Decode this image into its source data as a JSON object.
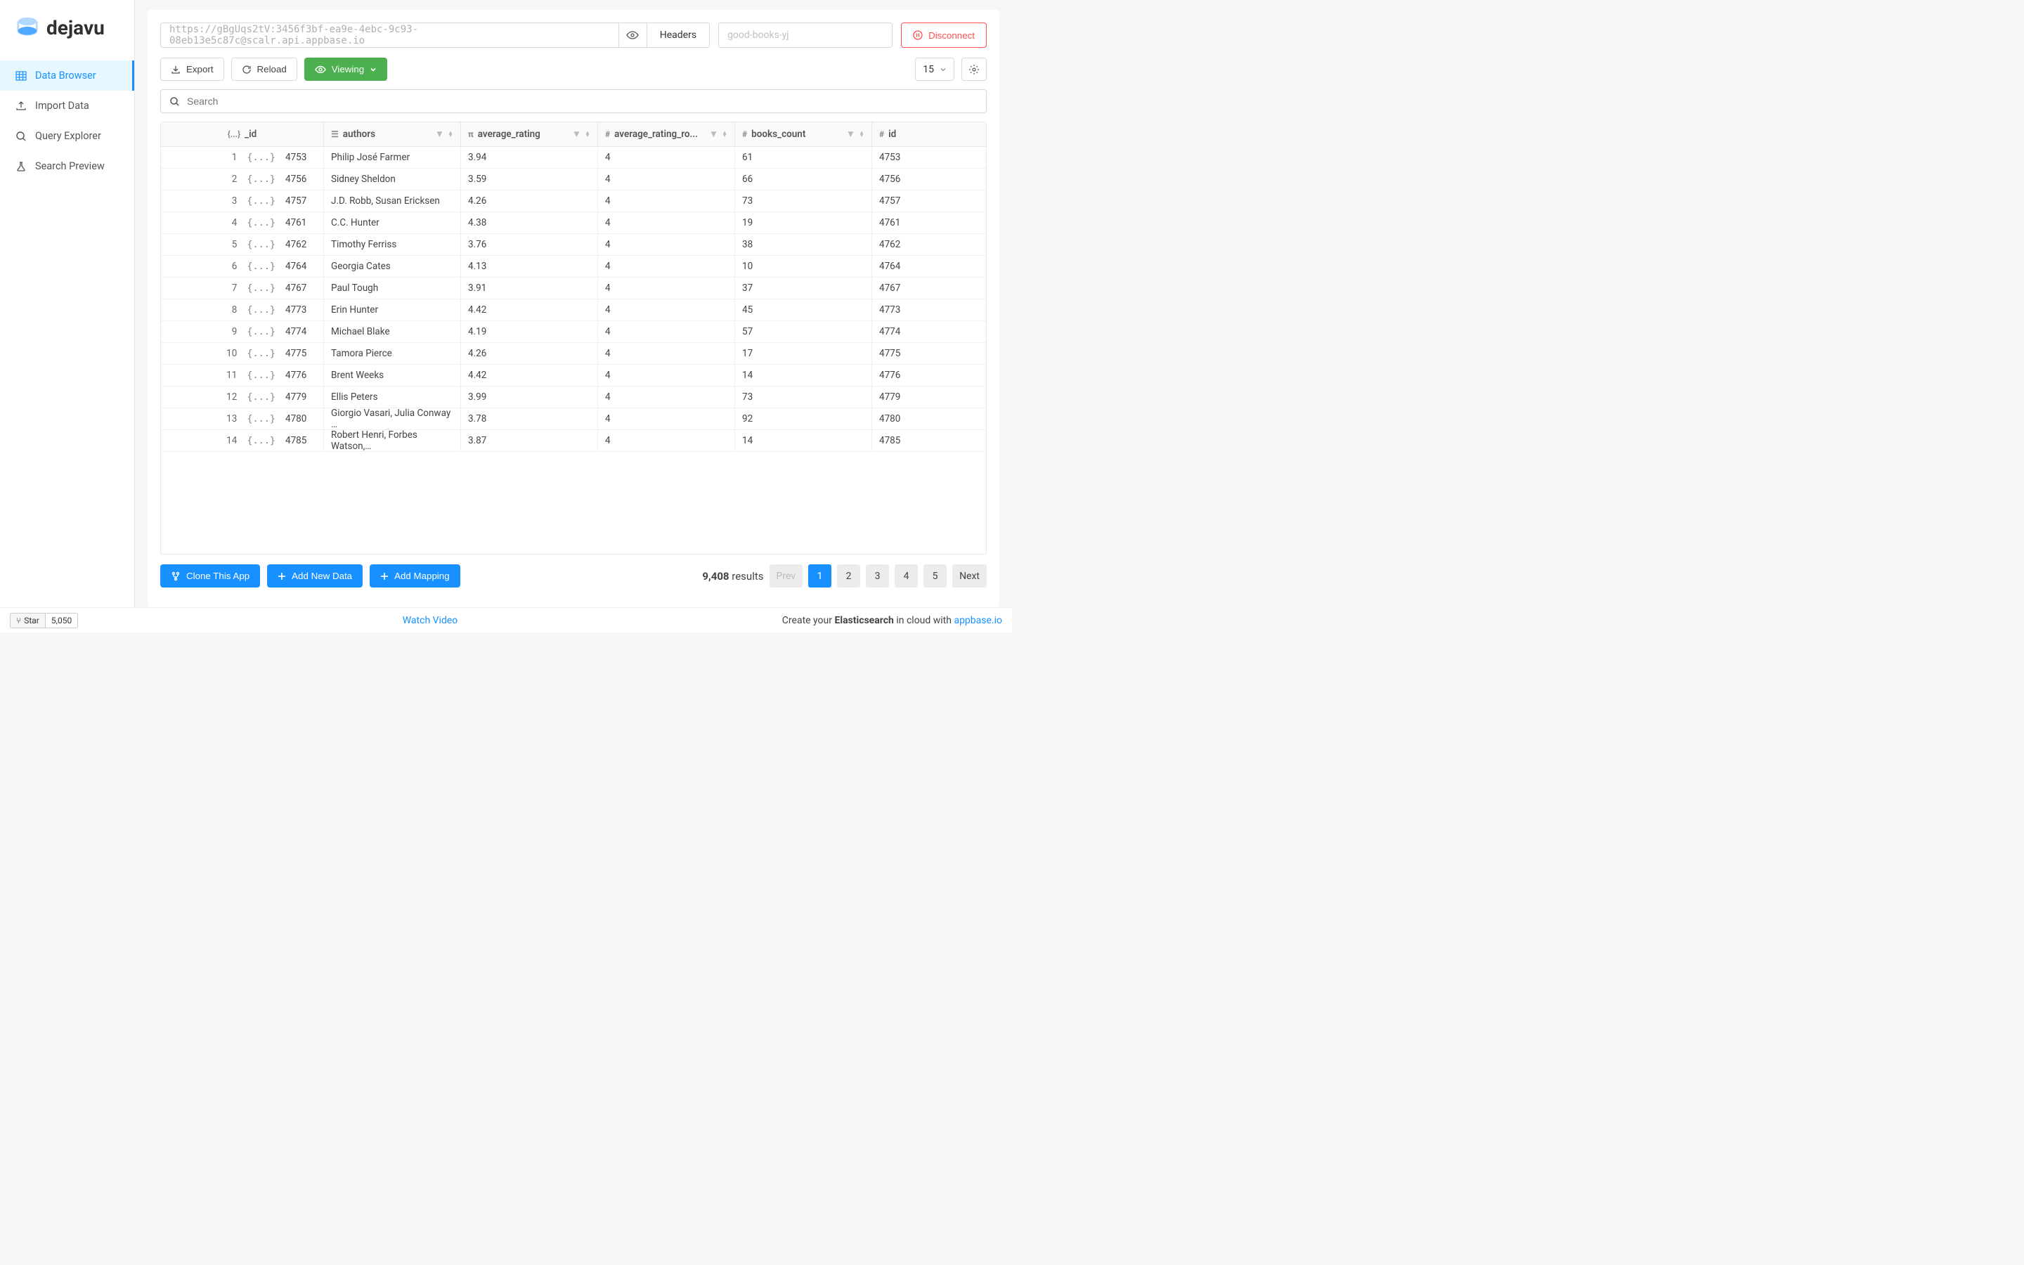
{
  "brand": "dejavu",
  "sidebar": {
    "items": [
      {
        "label": "Data Browser",
        "icon": "grid"
      },
      {
        "label": "Import Data",
        "icon": "upload"
      },
      {
        "label": "Query Explorer",
        "icon": "search"
      },
      {
        "label": "Search Preview",
        "icon": "flask"
      }
    ]
  },
  "header": {
    "url": "https://gBgUqs2tV:3456f3bf-ea9e-4ebc-9c93-08eb13e5c87c@scalr.api.appbase.io",
    "headers_btn": "Headers",
    "app_name": "good-books-yj",
    "disconnect": "Disconnect"
  },
  "toolbar": {
    "export": "Export",
    "reload": "Reload",
    "viewing": "Viewing",
    "page_size": "15"
  },
  "search": {
    "placeholder": "Search"
  },
  "columns": {
    "id_col": "_id",
    "authors": "authors",
    "avg_rating": "average_rating",
    "avg_rating_round": "average_rating_ro...",
    "books_count": "books_count",
    "id": "id"
  },
  "rows": [
    {
      "n": "1",
      "_id": "4753",
      "authors": "Philip José Farmer",
      "rating": "3.94",
      "round": "4",
      "books": "61",
      "id": "4753"
    },
    {
      "n": "2",
      "_id": "4756",
      "authors": "Sidney Sheldon",
      "rating": "3.59",
      "round": "4",
      "books": "66",
      "id": "4756"
    },
    {
      "n": "3",
      "_id": "4757",
      "authors": "J.D. Robb, Susan Ericksen",
      "rating": "4.26",
      "round": "4",
      "books": "73",
      "id": "4757"
    },
    {
      "n": "4",
      "_id": "4761",
      "authors": "C.C. Hunter",
      "rating": "4.38",
      "round": "4",
      "books": "19",
      "id": "4761"
    },
    {
      "n": "5",
      "_id": "4762",
      "authors": "Timothy Ferriss",
      "rating": "3.76",
      "round": "4",
      "books": "38",
      "id": "4762"
    },
    {
      "n": "6",
      "_id": "4764",
      "authors": "Georgia Cates",
      "rating": "4.13",
      "round": "4",
      "books": "10",
      "id": "4764"
    },
    {
      "n": "7",
      "_id": "4767",
      "authors": "Paul Tough",
      "rating": "3.91",
      "round": "4",
      "books": "37",
      "id": "4767"
    },
    {
      "n": "8",
      "_id": "4773",
      "authors": "Erin Hunter",
      "rating": "4.42",
      "round": "4",
      "books": "45",
      "id": "4773"
    },
    {
      "n": "9",
      "_id": "4774",
      "authors": "Michael Blake",
      "rating": "4.19",
      "round": "4",
      "books": "57",
      "id": "4774"
    },
    {
      "n": "10",
      "_id": "4775",
      "authors": "Tamora Pierce",
      "rating": "4.26",
      "round": "4",
      "books": "17",
      "id": "4775"
    },
    {
      "n": "11",
      "_id": "4776",
      "authors": "Brent Weeks",
      "rating": "4.42",
      "round": "4",
      "books": "14",
      "id": "4776"
    },
    {
      "n": "12",
      "_id": "4779",
      "authors": "Ellis Peters",
      "rating": "3.99",
      "round": "4",
      "books": "73",
      "id": "4779"
    },
    {
      "n": "13",
      "_id": "4780",
      "authors": "Giorgio Vasari, Julia Conway …",
      "rating": "3.78",
      "round": "4",
      "books": "92",
      "id": "4780"
    },
    {
      "n": "14",
      "_id": "4785",
      "authors": "Robert Henri, Forbes Watson,…",
      "rating": "3.87",
      "round": "4",
      "books": "14",
      "id": "4785"
    }
  ],
  "actions": {
    "clone": "Clone This App",
    "add_data": "Add New Data",
    "add_mapping": "Add Mapping"
  },
  "pagination": {
    "total": "9,408",
    "label": "results",
    "prev": "Prev",
    "pages": [
      "1",
      "2",
      "3",
      "4",
      "5"
    ],
    "next": "Next"
  },
  "footer": {
    "star": "Star",
    "count": "5,050",
    "video": "Watch Video",
    "promo_pre": "Create your ",
    "promo_bold": "Elasticsearch",
    "promo_post": " in cloud with ",
    "promo_link": "appbase.io"
  }
}
